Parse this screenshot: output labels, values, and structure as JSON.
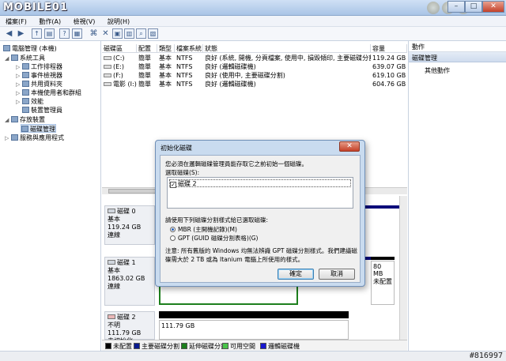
{
  "logo": "MOBILE01",
  "window_buttons": {
    "min": "–",
    "max": "□",
    "close": "✕"
  },
  "menu": [
    "檔案(F)",
    "動作(A)",
    "檢視(V)",
    "說明(H)"
  ],
  "tree": {
    "root": "電腦管理 (本機)",
    "system_tools": "系統工具",
    "task_scheduler": "工作排程器",
    "event_viewer": "事件檢視器",
    "shared_folders": "共用資料夾",
    "local_users": "本機使用者和群組",
    "performance": "效能",
    "device_manager": "裝置管理員",
    "storage": "存放裝置",
    "disk_management": "磁碟管理",
    "services": "服務與應用程式"
  },
  "volumes": {
    "headers": [
      "磁碟區",
      "配置",
      "類型",
      "檔案系統",
      "狀態",
      "容量"
    ],
    "rows": [
      {
        "name": "(C:)",
        "layout": "簡單",
        "type": "基本",
        "fs": "NTFS",
        "status": "良好 (系統, 開機, 分頁檔案, 使用中, 損毀傾印, 主要磁碟分割)",
        "capacity": "119.24 GB"
      },
      {
        "name": "(E:)",
        "layout": "簡單",
        "type": "基本",
        "fs": "NTFS",
        "status": "良好 (邏輯磁碟機)",
        "capacity": "639.07 GB"
      },
      {
        "name": "(F:)",
        "layout": "簡單",
        "type": "基本",
        "fs": "NTFS",
        "status": "良好 (使用中, 主要磁碟分割)",
        "capacity": "619.10 GB"
      },
      {
        "name": "電影 (I:)",
        "layout": "簡單",
        "type": "基本",
        "fs": "NTFS",
        "status": "良好 (邏輯磁碟機)",
        "capacity": "604.76 GB"
      }
    ]
  },
  "disks": [
    {
      "name": "磁碟 0",
      "type": "基本",
      "size": "119.24 GB",
      "state": "連線"
    },
    {
      "name": "磁碟 1",
      "type": "基本",
      "size": "1863.02 GB",
      "state": "連線",
      "partial": "80 MB",
      "partial_state": "未配置"
    },
    {
      "name": "磁碟 2",
      "type": "不明",
      "size": "111.79 GB",
      "state": "未初始化",
      "part_size": "111.79 GB"
    }
  ],
  "legend": [
    {
      "label": "未配置",
      "color": "#000000"
    },
    {
      "label": "主要磁碟分割",
      "color": "#0b1b8f"
    },
    {
      "label": "延伸磁碟分割",
      "color": "#1d7f1d"
    },
    {
      "label": "可用空間",
      "color": "#49c449"
    },
    {
      "label": "邏輯磁碟機",
      "color": "#1818d0"
    }
  ],
  "actions": {
    "title": "動作",
    "section": "磁碟管理",
    "more": "其他動作"
  },
  "dialog": {
    "title": "初始化磁碟",
    "close": "✕",
    "intro": "您必須在邏輯磁碟管理員能存取它之前初始一個磁碟。",
    "select_label": "選取磁碟(S):",
    "disk_item": "磁碟 2",
    "style_label": "請使用下列磁碟分割樣式給已選取磁碟:",
    "mbr": "MBR (主開機記錄)(M)",
    "gpt": "GPT (GUID 磁碟分割表格)(G)",
    "note1": "注意: 所有舊版的 Windows 均無法辨識 GPT 磁碟分割樣式。我們建議磁",
    "note2": "碟需大於 2 TB 或為 Itanium 電腦上所使用的樣式。",
    "ok": "確定",
    "cancel": "取消"
  },
  "watermark": "#816997"
}
